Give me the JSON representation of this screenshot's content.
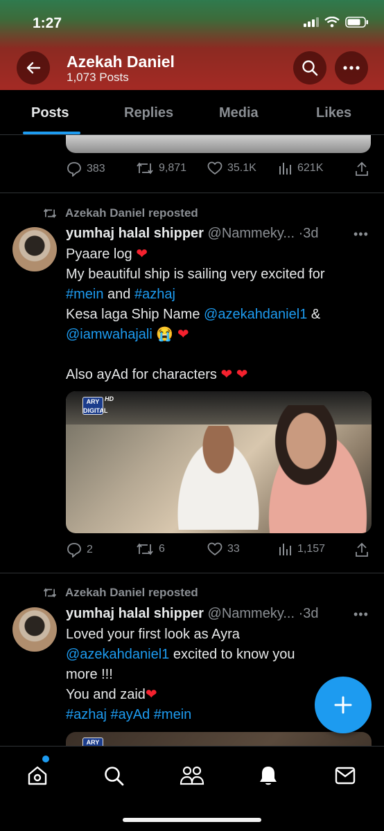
{
  "status_bar": {
    "time": "1:27"
  },
  "header": {
    "profile_name": "Azekah Daniel",
    "post_count": "1,073 Posts"
  },
  "tabs": [
    {
      "label": "Posts",
      "active": true
    },
    {
      "label": "Replies",
      "active": false
    },
    {
      "label": "Media",
      "active": false
    },
    {
      "label": "Likes",
      "active": false
    }
  ],
  "previous_post": {
    "replies": "383",
    "reposts": "9,871",
    "likes": "35.1K",
    "views": "621K"
  },
  "tweets": [
    {
      "repost_label": "Azekah Daniel reposted",
      "name": "yumhaj halal shipper",
      "handle": "@Nammeky...",
      "time": "·3d",
      "lines": {
        "l1": "Pyaare log",
        "l2": "My beautiful ship is sailing very excited for",
        "l3a": "#mein",
        "l3b": " and ",
        "l3c": "#azhaj",
        "l4a": "Kesa laga Ship Name ",
        "l4b": "@azekahdaniel1",
        "l4c": " &",
        "l5a": "@iamwahajali",
        "l5b": " 😭",
        "l6": "Also ayAd for characters"
      },
      "media_logo": "ARY DIGITAL",
      "media_hd": "HD",
      "stats": {
        "replies": "2",
        "reposts": "6",
        "likes": "33",
        "views": "1,157"
      }
    },
    {
      "repost_label": "Azekah Daniel reposted",
      "name": "yumhaj halal shipper",
      "handle": "@Nammeky...",
      "time": "·3d",
      "lines": {
        "l1": "Loved your first look as Ayra",
        "l2a": "@azekahdaniel1",
        "l2b": " excited to know you",
        "l3": "more !!!",
        "l4": "You and zaid",
        "l5a": "#azhaj",
        "l5b": "#ayAd",
        "l5c": "#mein"
      },
      "media_logo": "ARY DIGITAL"
    }
  ],
  "colors": {
    "accent": "#1d9bf0",
    "heart": "#f4212e",
    "header_top": "#2f7a4e",
    "header_bottom": "#a42a24"
  },
  "icons": [
    "back-arrow-icon",
    "search-icon",
    "more-icon",
    "repost-icon",
    "reply-icon",
    "like-icon",
    "views-icon",
    "share-icon",
    "home-icon",
    "communities-icon",
    "notifications-icon",
    "messages-icon",
    "compose-icon"
  ]
}
